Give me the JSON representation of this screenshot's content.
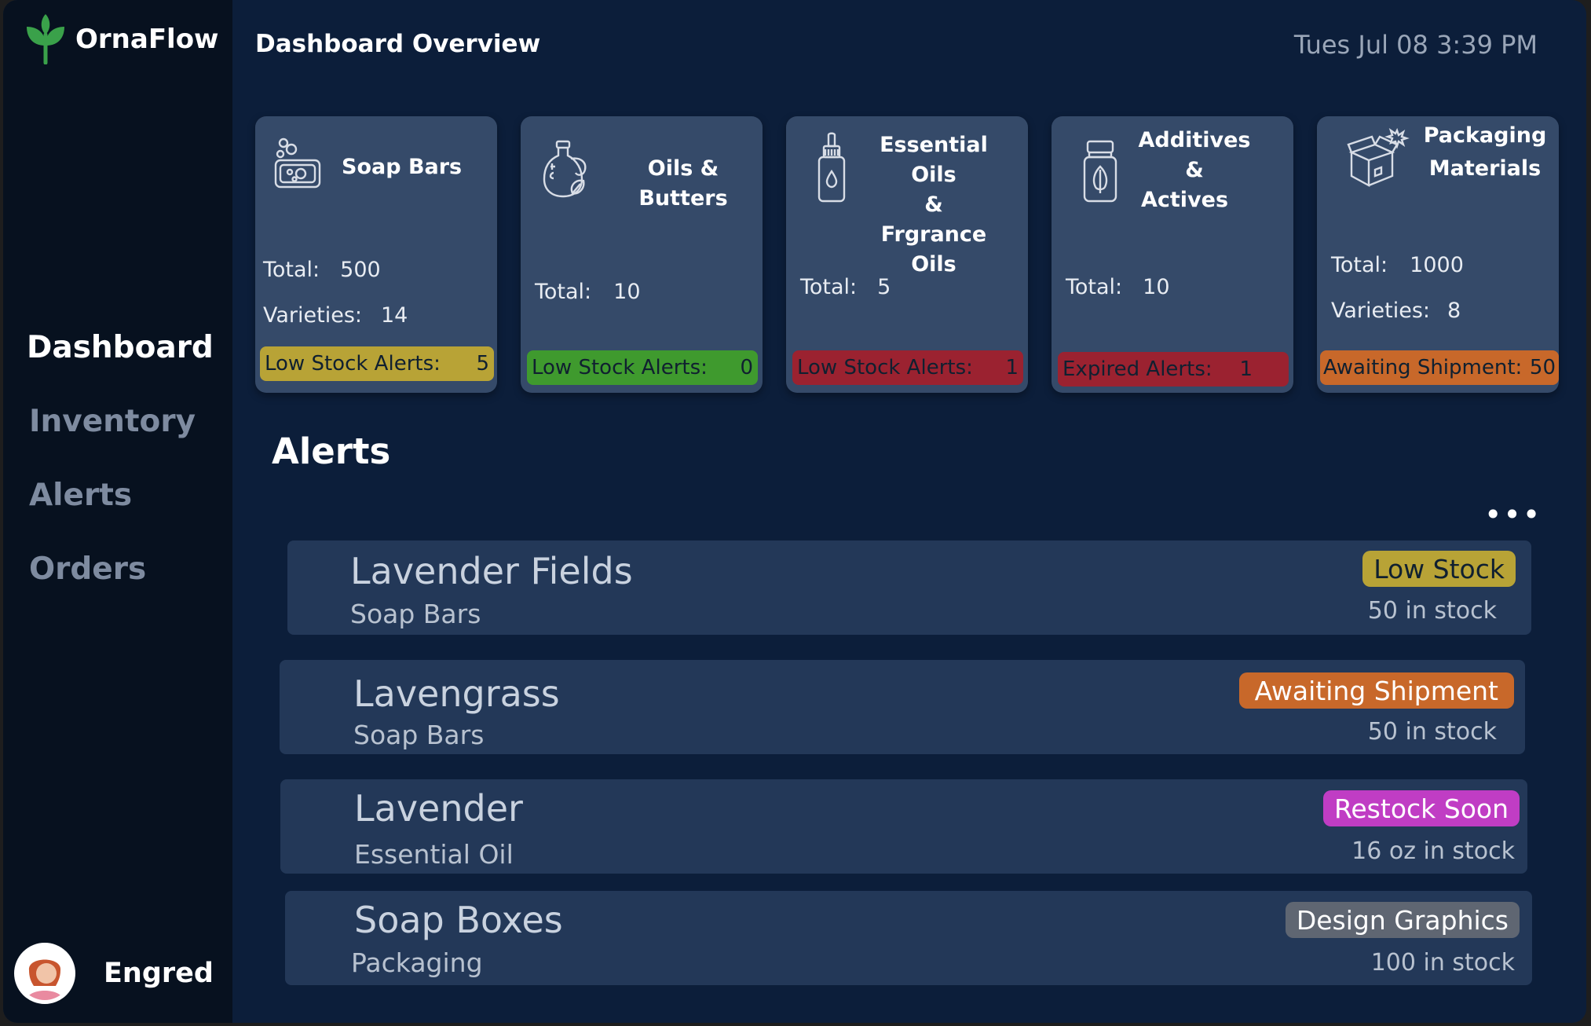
{
  "brand": {
    "name": "OrnaFlow",
    "accent": "#3aa14a"
  },
  "nav": {
    "items": [
      {
        "label": "Dashboard",
        "active": true
      },
      {
        "label": "Inventory",
        "active": false
      },
      {
        "label": "Alerts",
        "active": false
      },
      {
        "label": "Orders",
        "active": false
      }
    ]
  },
  "user": {
    "name": "Engred",
    "avatar_icon": "user-avatar-icon"
  },
  "header": {
    "title": "Dashboard Overview",
    "datetime": "Tues Jul 08 3:39 PM"
  },
  "cards": [
    {
      "title_lines": [
        "Soap Bars"
      ],
      "icon": "soap-bar-icon",
      "stats": [
        {
          "label": "Total:",
          "value": "500"
        },
        {
          "label": "Varieties:",
          "value": "14"
        }
      ],
      "badge": {
        "label": "Low Stock Alerts:",
        "value": "5",
        "color": "#b8a336"
      }
    },
    {
      "title_lines": [
        "Oils & Butters"
      ],
      "icon": "oil-jar-icon",
      "stats": [
        {
          "label": "Total:",
          "value": "10"
        }
      ],
      "badge": {
        "label": "Low Stock Alerts:",
        "value": "0",
        "color": "#3f9a2e"
      }
    },
    {
      "title_lines": [
        "Essential Oils",
        "&",
        "Frgrance Oils"
      ],
      "icon": "dropper-bottle-icon",
      "stats": [
        {
          "label": "Total:",
          "value": "5"
        }
      ],
      "badge": {
        "label": "Low Stock Alerts:",
        "value": "1",
        "color": "#9b2230"
      }
    },
    {
      "title_lines": [
        "Additives",
        "&",
        "Actives"
      ],
      "icon": "leaf-jar-icon",
      "stats": [
        {
          "label": "Total:",
          "value": "10"
        }
      ],
      "badge": {
        "label": "Expired Alerts:",
        "value": "1",
        "color": "#9b2230"
      }
    },
    {
      "title_lines": [
        "Packaging",
        "Materials"
      ],
      "icon": "box-icon",
      "stats": [
        {
          "label": "Total:",
          "value": "1000"
        },
        {
          "label": "Varieties:",
          "value": "8"
        }
      ],
      "badge": {
        "label": "Awaiting Shipment:",
        "value": "50",
        "color": "#c8682a"
      }
    }
  ],
  "alerts": {
    "title": "Alerts",
    "more": "•••",
    "rows": [
      {
        "name": "Lavender Fields",
        "category": "Soap Bars",
        "tag": "Low Stock",
        "tag_bg": "#b8a336",
        "tag_fg": "#102030",
        "stock": "50 in stock"
      },
      {
        "name": "Lavengrass",
        "category": "Soap Bars",
        "tag": "Awaiting Shipment",
        "tag_bg": "#c8682a",
        "tag_fg": "#ffffff",
        "stock": "50 in stock"
      },
      {
        "name": "Lavender",
        "category": "Essential Oil",
        "tag": "Restock Soon",
        "tag_bg": "#c03dc4",
        "tag_fg": "#ffffff",
        "stock": "16 oz in stock"
      },
      {
        "name": "Soap Boxes",
        "category": "Packaging",
        "tag": "Design Graphics",
        "tag_bg": "#5f6672",
        "tag_fg": "#ffffff",
        "stock": "100 in stock"
      }
    ]
  }
}
